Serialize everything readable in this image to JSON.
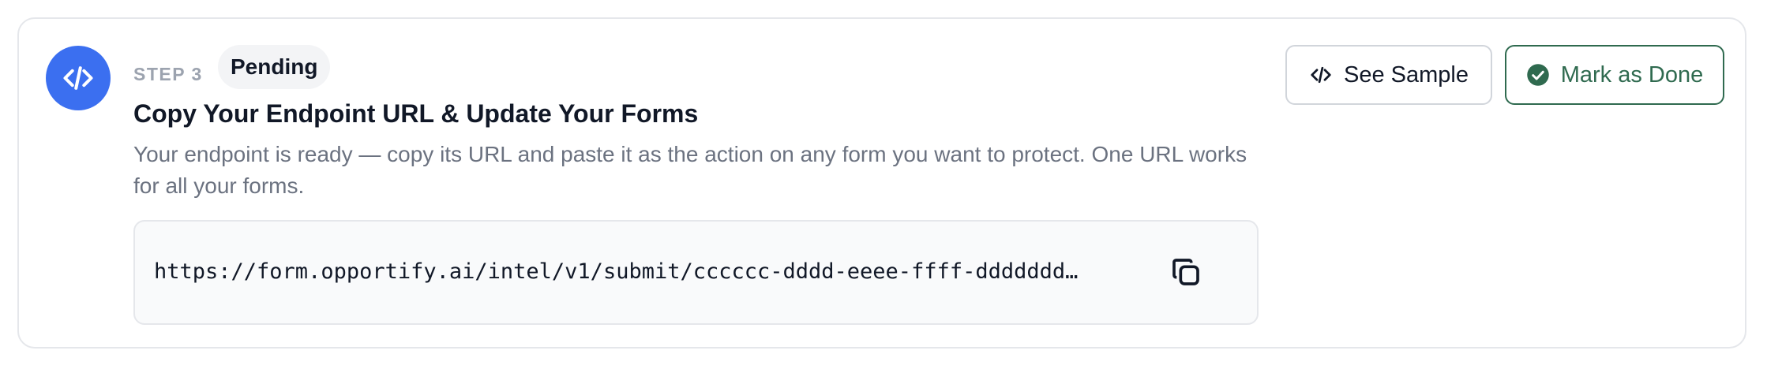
{
  "step": {
    "label": "STEP 3",
    "status": "Pending",
    "icon": "code-icon",
    "accent_color": "#3b6ff0"
  },
  "title": "Copy Your Endpoint URL & Update Your Forms",
  "description": "Your endpoint is ready — copy its URL and paste it as the action on any form you want to protect. One URL works for all your forms.",
  "endpoint": {
    "url": "https://form.opportify.ai/intel/v1/submit/cccccc-dddd-eeee-ffff-ddddddd…",
    "copy_icon": "copy-icon"
  },
  "actions": {
    "see_sample_label": "See Sample",
    "see_sample_icon": "code-icon",
    "mark_done_label": "Mark as Done",
    "mark_done_icon": "check-circle-icon",
    "done_color": "#2f6a4f"
  }
}
